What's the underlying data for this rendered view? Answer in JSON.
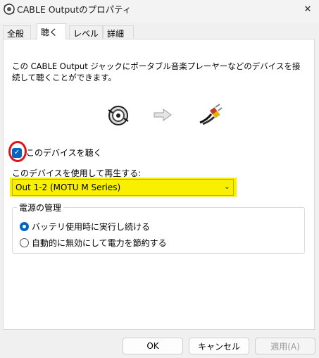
{
  "window": {
    "title": "CABLE Outputのプロパティ",
    "close_glyph": "✕"
  },
  "tabs": [
    {
      "label": "全般"
    },
    {
      "label": "聴く",
      "active": true
    },
    {
      "label": "レベル"
    },
    {
      "label": "詳細"
    }
  ],
  "listen": {
    "description": "この CABLE Output ジャックにポータブル音楽プレーヤーなどのデバイスを接続して聴くことができます。",
    "devices_icons": [
      "device-jack-icon",
      "arrow-right-icon",
      "rca-cable-icon"
    ],
    "checkbox_label": "このデバイスを聴く",
    "checkbox_checked": true,
    "playback_label": "このデバイスを使用して再生する:",
    "playback_device": "Out 1-2 (MOTU M Series)",
    "chevron_glyph": "⌄"
  },
  "power": {
    "title": "電源の管理",
    "options": [
      {
        "label": "バッテリ使用時に実行し続ける",
        "selected": true
      },
      {
        "label": "自動的に無効にして電力を節約する",
        "selected": false
      }
    ]
  },
  "buttons": {
    "ok": "OK",
    "cancel": "キャンセル",
    "apply": "適用(A)"
  },
  "colors": {
    "accent": "#0067c0",
    "highlight": "#f8f000",
    "annotation_red": "#e0121a"
  }
}
